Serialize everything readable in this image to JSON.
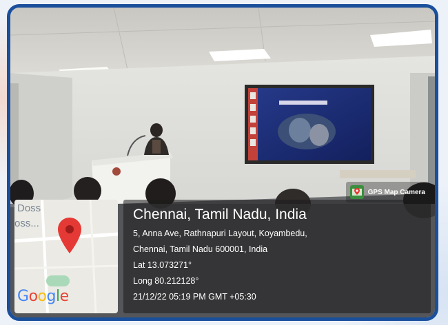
{
  "watermark": {
    "label": "GPS Map Camera",
    "icon": "gps-map-camera-icon"
  },
  "map": {
    "road_labels": [
      "Doss",
      "oss..."
    ],
    "logo_text": "Google",
    "pin_icon": "location-pin-icon",
    "pin_color": "#e53935"
  },
  "location": {
    "title": "Chennai, Tamil Nadu, India",
    "address_line_1": "5, Anna Ave, Rathnapuri Layout, Koyambedu,",
    "address_line_2": "Chennai, Tamil Nadu 600001, India",
    "latitude": "Lat 13.073271°",
    "longitude": "Long 80.212128°",
    "timestamp": "21/12/22 05:19 PM GMT +05:30"
  },
  "colors": {
    "frame_border": "#1a4f9c"
  }
}
